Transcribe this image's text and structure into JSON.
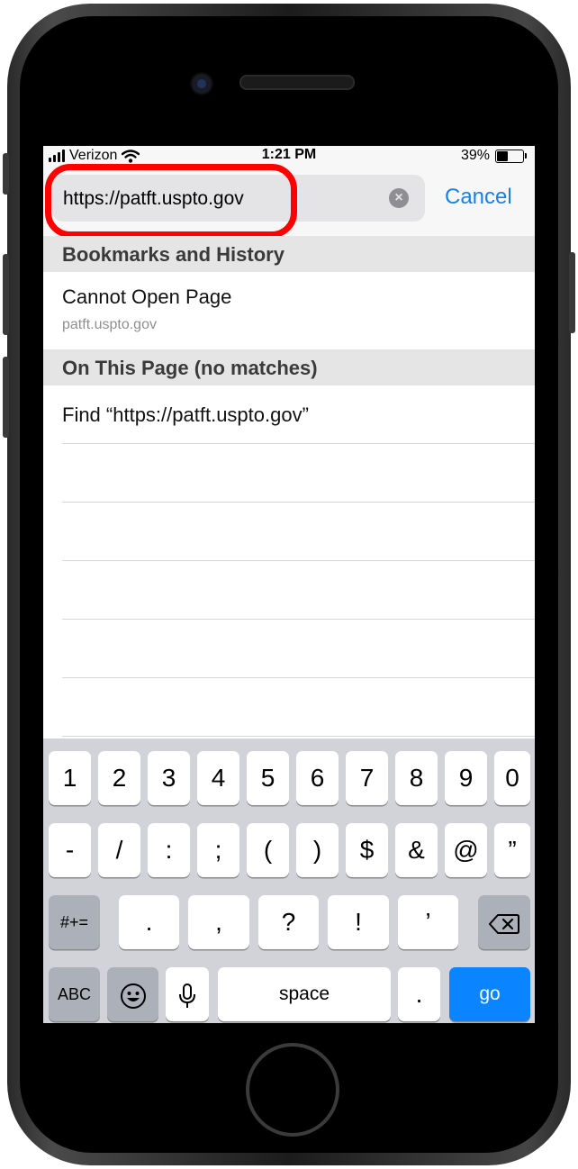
{
  "status_bar": {
    "carrier": "Verizon",
    "time": "1:21 PM",
    "battery_percent": "39%",
    "battery_level": 0.39
  },
  "toolbar": {
    "url": "https://patft.uspto.gov",
    "cancel_label": "Cancel",
    "clear_icon": "clear-circle-icon"
  },
  "sections": {
    "bookmarks_header": "Bookmarks and History",
    "bookmark_item": {
      "title": "Cannot Open Page",
      "subtitle": "patft.uspto.gov"
    },
    "on_page_header": "On This Page (no matches)",
    "find_item": "Find “https://patft.uspto.gov”"
  },
  "keyboard": {
    "row1": [
      "1",
      "2",
      "3",
      "4",
      "5",
      "6",
      "7",
      "8",
      "9",
      "0"
    ],
    "row2": [
      "-",
      "/",
      ":",
      ";",
      "(",
      ")",
      "$",
      "&",
      "@",
      "”"
    ],
    "row3": {
      "shift": "#+=",
      "keys": [
        ".",
        ",",
        "?",
        "!",
        "’"
      ],
      "delete_icon": "backspace-icon"
    },
    "row4": {
      "abc": "ABC",
      "emoji_icon": "emoji-icon",
      "mic_icon": "microphone-icon",
      "space": "space",
      "dot": ".",
      "go": "go"
    }
  },
  "colors": {
    "accent": "#1a80e6",
    "highlight_ring": "#ff0000",
    "go_key": "#0a84ff"
  }
}
